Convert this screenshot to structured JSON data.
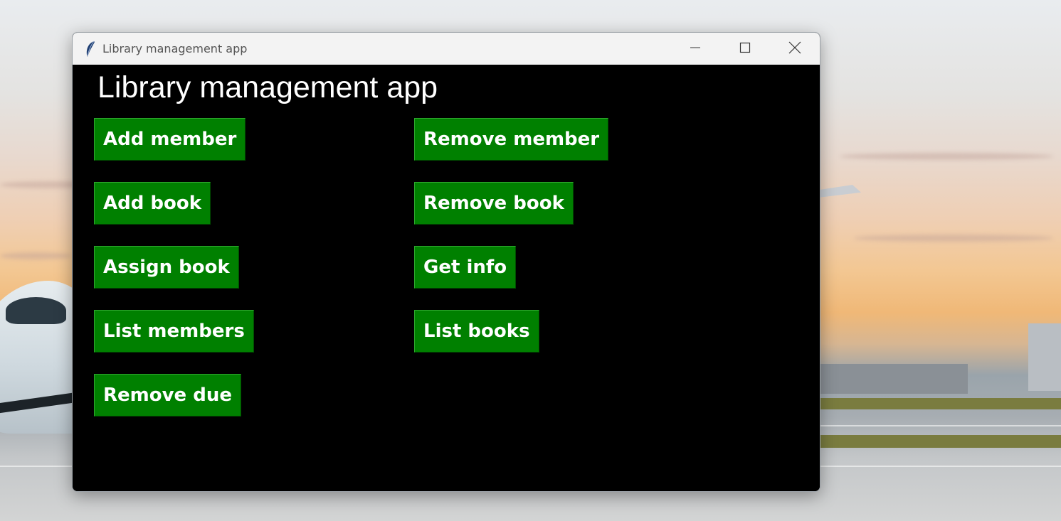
{
  "window": {
    "title": "Library management app",
    "controls": {
      "minimize_icon": "minimize-icon",
      "maximize_icon": "maximize-icon",
      "close_icon": "close-icon"
    }
  },
  "main": {
    "heading": "Library management app",
    "buttons": {
      "add_member": "Add member",
      "remove_member": "Remove member",
      "add_book": "Add book",
      "remove_book": "Remove book",
      "assign_book": "Assign book",
      "get_info": "Get info",
      "list_members": "List members",
      "list_books": "List books",
      "remove_due": "Remove due"
    }
  },
  "colors": {
    "button_background": "#008000",
    "button_text": "#ffffff",
    "client_background": "#000000",
    "titlebar_background": "#f3f3f3"
  }
}
